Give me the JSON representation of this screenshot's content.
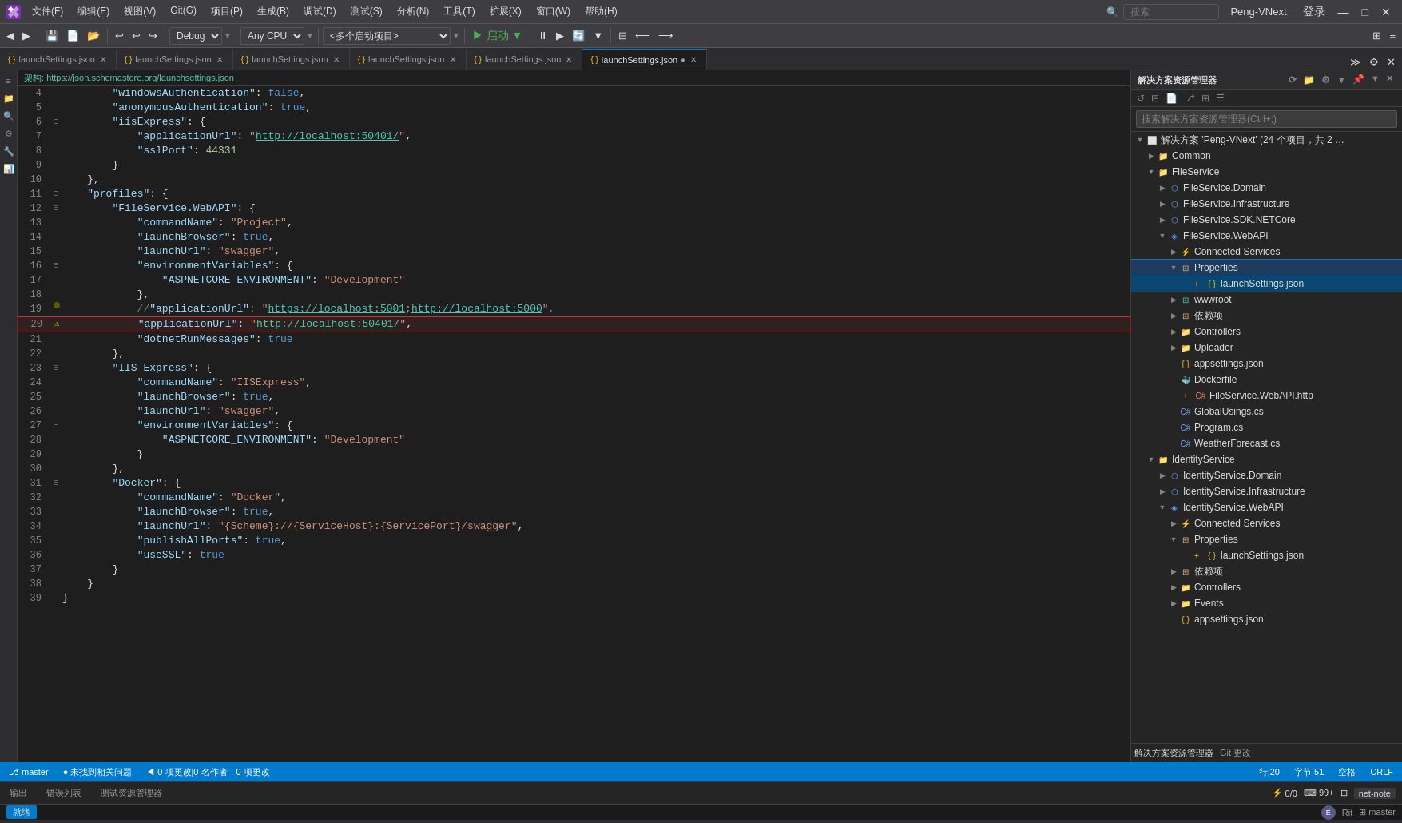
{
  "titleBar": {
    "logo": "VS",
    "menus": [
      "文件(F)",
      "编辑(E)",
      "视图(V)",
      "Git(G)",
      "项目(P)",
      "生成(B)",
      "调试(D)",
      "测试(S)",
      "分析(N)",
      "工具(T)",
      "扩展(X)",
      "窗口(W)",
      "帮助(H)"
    ],
    "searchPlaceholder": "搜索",
    "projectName": "Peng-VNext",
    "loginLabel": "登录",
    "windowBtns": [
      "—",
      "□",
      "✕"
    ]
  },
  "toolbar": {
    "navBtns": [
      "◀",
      "▶"
    ],
    "saveBtns": [
      "💾",
      "📋",
      "📋"
    ],
    "undoBtns": [
      "↩",
      "↩",
      "↪"
    ],
    "buildConfig": "Debug",
    "platform": "Any CPU",
    "startupProject": "<多个启动项目>",
    "runBtn": "▶ 启动 ▼",
    "extraBtns": [
      "⏸",
      "▶",
      "🔄",
      "▼"
    ]
  },
  "tabs": [
    {
      "label": "launchSettings.json",
      "active": false,
      "modified": false
    },
    {
      "label": "launchSettings.json",
      "active": false,
      "modified": false
    },
    {
      "label": "launchSettings.json",
      "active": false,
      "modified": false
    },
    {
      "label": "launchSettings.json",
      "active": false,
      "modified": false
    },
    {
      "label": "launchSettings.json",
      "active": false,
      "modified": false
    },
    {
      "label": "launchSettings.json",
      "active": true,
      "modified": true
    }
  ],
  "schemaBar": {
    "label": "架构:",
    "url": "https://json.schemastore.org/launchsettings.json"
  },
  "codeLines": [
    {
      "num": 4,
      "indent": 8,
      "content": "\"windowsAuthentication\": false,",
      "type": "kv",
      "key": "windowsAuthentication",
      "val": "false"
    },
    {
      "num": 5,
      "indent": 8,
      "content": "\"anonymousAuthentication\": true,",
      "type": "kv",
      "key": "anonymousAuthentication",
      "val": "true"
    },
    {
      "num": 6,
      "indent": 8,
      "content": "\"iisExpress\": {",
      "type": "block-open",
      "hasCollapse": true
    },
    {
      "num": 7,
      "indent": 12,
      "content": "\"applicationUrl\": \"http://localhost:50401/\",",
      "type": "kv-url",
      "key": "applicationUrl",
      "val": "http://localhost:50401/"
    },
    {
      "num": 8,
      "indent": 12,
      "content": "\"sslPort\": 44331",
      "type": "kv",
      "key": "sslPort",
      "val": "44331"
    },
    {
      "num": 9,
      "indent": 8,
      "content": "}",
      "type": "block-close"
    },
    {
      "num": 10,
      "indent": 4,
      "content": "},",
      "type": "block-close-comma"
    },
    {
      "num": 11,
      "indent": 4,
      "content": "\"profiles\": {",
      "type": "block-open",
      "hasCollapse": true
    },
    {
      "num": 12,
      "indent": 8,
      "content": "\"FileService.WebAPI\": {",
      "type": "block-open",
      "hasCollapse": true
    },
    {
      "num": 13,
      "indent": 12,
      "content": "\"commandName\": \"Project\",",
      "type": "kv",
      "key": "commandName",
      "val": "Project"
    },
    {
      "num": 14,
      "indent": 12,
      "content": "\"launchBrowser\": true,",
      "type": "kv",
      "key": "launchBrowser",
      "val": "true"
    },
    {
      "num": 15,
      "indent": 12,
      "content": "\"launchUrl\": \"swagger\",",
      "type": "kv",
      "key": "launchUrl",
      "val": "swagger"
    },
    {
      "num": 16,
      "indent": 12,
      "content": "\"environmentVariables\": {",
      "type": "block-open",
      "hasCollapse": true
    },
    {
      "num": 17,
      "indent": 16,
      "content": "\"ASPNETCORE_ENVIRONMENT\": \"Development\"",
      "type": "kv",
      "key": "ASPNETCORE_ENVIRONMENT",
      "val": "Development"
    },
    {
      "num": 18,
      "indent": 12,
      "content": "},",
      "type": "block-close-comma"
    },
    {
      "num": 19,
      "indent": 12,
      "content": "//\"applicationUrl\": \"https://localhost:5001;http://localhost:5000\",",
      "type": "comment"
    },
    {
      "num": 20,
      "indent": 12,
      "content": "\"applicationUrl\": \"http://localhost:50401/\",",
      "type": "kv-url-boxed",
      "key": "applicationUrl",
      "val": "http://localhost:50401/",
      "boxed": true,
      "hasWarning": true
    },
    {
      "num": 21,
      "indent": 12,
      "content": "\"dotnetRunMessages\": true",
      "type": "kv",
      "key": "dotnetRunMessages",
      "val": "true"
    },
    {
      "num": 22,
      "indent": 8,
      "content": "},",
      "type": "block-close-comma"
    },
    {
      "num": 23,
      "indent": 8,
      "content": "\"IIS Express\": {",
      "type": "block-open",
      "hasCollapse": true
    },
    {
      "num": 24,
      "indent": 12,
      "content": "\"commandName\": \"IISExpress\",",
      "type": "kv",
      "key": "commandName",
      "val": "IISExpress"
    },
    {
      "num": 25,
      "indent": 12,
      "content": "\"launchBrowser\": true,",
      "type": "kv",
      "key": "launchBrowser",
      "val": "true"
    },
    {
      "num": 26,
      "indent": 12,
      "content": "\"launchUrl\": \"swagger\",",
      "type": "kv",
      "key": "launchUrl",
      "val": "swagger"
    },
    {
      "num": 27,
      "indent": 12,
      "content": "\"environmentVariables\": {",
      "type": "block-open",
      "hasCollapse": true
    },
    {
      "num": 28,
      "indent": 16,
      "content": "\"ASPNETCORE_ENVIRONMENT\": \"Development\"",
      "type": "kv",
      "key": "ASPNETCORE_ENVIRONMENT",
      "val": "Development"
    },
    {
      "num": 29,
      "indent": 12,
      "content": "}",
      "type": "block-close"
    },
    {
      "num": 30,
      "indent": 8,
      "content": "},",
      "type": "block-close-comma"
    },
    {
      "num": 31,
      "indent": 8,
      "content": "\"Docker\": {",
      "type": "block-open",
      "hasCollapse": true
    },
    {
      "num": 32,
      "indent": 12,
      "content": "\"commandName\": \"Docker\",",
      "type": "kv",
      "key": "commandName",
      "val": "Docker"
    },
    {
      "num": 33,
      "indent": 12,
      "content": "\"launchBrowser\": true,",
      "type": "kv",
      "key": "launchBrowser",
      "val": "true"
    },
    {
      "num": 34,
      "indent": 12,
      "content": "\"launchUrl\": \"{Scheme}://{ServiceHost}:{ServicePort}/swagger\",",
      "type": "kv",
      "key": "launchUrl",
      "val": "{Scheme}://{ServiceHost}:{ServicePort}/swagger"
    },
    {
      "num": 35,
      "indent": 12,
      "content": "\"publishAllPorts\": true,",
      "type": "kv",
      "key": "publishAllPorts",
      "val": "true"
    },
    {
      "num": 36,
      "indent": 12,
      "content": "\"useSSL\": true",
      "type": "kv",
      "key": "useSSL",
      "val": "true"
    },
    {
      "num": 37,
      "indent": 8,
      "content": "}",
      "type": "block-close"
    },
    {
      "num": 38,
      "indent": 4,
      "content": "}",
      "type": "block-close"
    },
    {
      "num": 39,
      "indent": 0,
      "content": "}",
      "type": "block-close"
    }
  ],
  "rightPanel": {
    "title": "解决方案资源管理器",
    "searchPlaceholder": "搜索解决方案资源管理器(Ctrl+;)",
    "solutionLabel": "解决方案 'Peng-VNext' (24 个项目，共 2 …",
    "tree": [
      {
        "id": "common",
        "label": "Common",
        "type": "folder",
        "indent": 1,
        "expanded": false
      },
      {
        "id": "fileservice",
        "label": "FileService",
        "type": "folder",
        "indent": 1,
        "expanded": true
      },
      {
        "id": "fileservice-domain",
        "label": "FileService.Domain",
        "type": "project-ref",
        "indent": 2,
        "expanded": false
      },
      {
        "id": "fileservice-infra",
        "label": "FileService.Infrastructure",
        "type": "project-ref",
        "indent": 2,
        "expanded": false
      },
      {
        "id": "fileservice-sdk",
        "label": "FileService.SDK.NETCore",
        "type": "project-ref",
        "indent": 2,
        "expanded": false
      },
      {
        "id": "fileservice-webapi",
        "label": "FileService.WebAPI",
        "type": "project",
        "indent": 2,
        "expanded": true
      },
      {
        "id": "connected-services",
        "label": "Connected Services",
        "type": "folder-special",
        "indent": 3,
        "expanded": false
      },
      {
        "id": "properties",
        "label": "Properties",
        "type": "folder-special",
        "indent": 3,
        "expanded": true,
        "selected": true
      },
      {
        "id": "launchsettings",
        "label": "launchSettings.json",
        "type": "json",
        "indent": 4,
        "selected": true,
        "active": true
      },
      {
        "id": "wwwroot",
        "label": "wwwroot",
        "type": "folder-special",
        "indent": 3,
        "expanded": false
      },
      {
        "id": "depend",
        "label": "依赖项",
        "type": "folder-special",
        "indent": 3,
        "expanded": false
      },
      {
        "id": "controllers",
        "label": "Controllers",
        "type": "folder",
        "indent": 3,
        "expanded": false
      },
      {
        "id": "uploader",
        "label": "Uploader",
        "type": "folder",
        "indent": 3,
        "expanded": false
      },
      {
        "id": "appsettings",
        "label": "appsettings.json",
        "type": "json",
        "indent": 3,
        "expanded": false
      },
      {
        "id": "dockerfile",
        "label": "Dockerfile",
        "type": "docker",
        "indent": 3
      },
      {
        "id": "fileservice-http",
        "label": "FileService.WebAPI.http",
        "type": "http",
        "indent": 3
      },
      {
        "id": "globalusings",
        "label": "GlobalUsings.cs",
        "type": "cs",
        "indent": 3
      },
      {
        "id": "program",
        "label": "Program.cs",
        "type": "cs",
        "indent": 3
      },
      {
        "id": "weatherforecast",
        "label": "WeatherForecast.cs",
        "type": "cs",
        "indent": 3
      },
      {
        "id": "identityservice",
        "label": "IdentityService",
        "type": "folder",
        "indent": 1,
        "expanded": true
      },
      {
        "id": "identityservice-domain",
        "label": "IdentityService.Domain",
        "type": "project-ref",
        "indent": 2,
        "expanded": false
      },
      {
        "id": "identityservice-infra",
        "label": "IdentityService.Infrastructure",
        "type": "project-ref",
        "indent": 2,
        "expanded": false
      },
      {
        "id": "identityservice-webapi",
        "label": "IdentityService.WebAPI",
        "type": "project",
        "indent": 2,
        "expanded": true
      },
      {
        "id": "id-connected-services",
        "label": "Connected Services",
        "type": "folder-special",
        "indent": 3,
        "expanded": false
      },
      {
        "id": "id-properties",
        "label": "Properties",
        "type": "folder-special",
        "indent": 3,
        "expanded": true
      },
      {
        "id": "id-launchsettings",
        "label": "launchSettings.json",
        "type": "json",
        "indent": 4
      },
      {
        "id": "id-depend",
        "label": "依赖项",
        "type": "folder-special",
        "indent": 3,
        "expanded": false
      },
      {
        "id": "id-controllers",
        "label": "Controllers",
        "type": "folder",
        "indent": 3,
        "expanded": false
      },
      {
        "id": "id-events",
        "label": "Events",
        "type": "folder",
        "indent": 3,
        "expanded": false
      },
      {
        "id": "id-appsettings",
        "label": "appsettings.json",
        "type": "json",
        "indent": 3
      }
    ]
  },
  "statusBar": {
    "gitBranch": "master",
    "errors": "0",
    "warnings": "0",
    "noIssues": "未找到相关问题",
    "pending": "◀ 0 项更改|0 名作者，0 项更改",
    "row": "行:20",
    "col": "字节:51",
    "space": "空格",
    "encoding": "CRLF",
    "rightLabel1": "解决方案资源管理器",
    "rightLabel2": "Git 更改",
    "notifications": "0/0",
    "editorCount": "99+"
  },
  "bottomTabs": [
    {
      "label": "输出",
      "active": false
    },
    {
      "label": "错误列表",
      "active": false
    },
    {
      "label": "测试资源管理器",
      "active": false
    }
  ],
  "footerLeft": "就绪",
  "footerRight": "Rit"
}
